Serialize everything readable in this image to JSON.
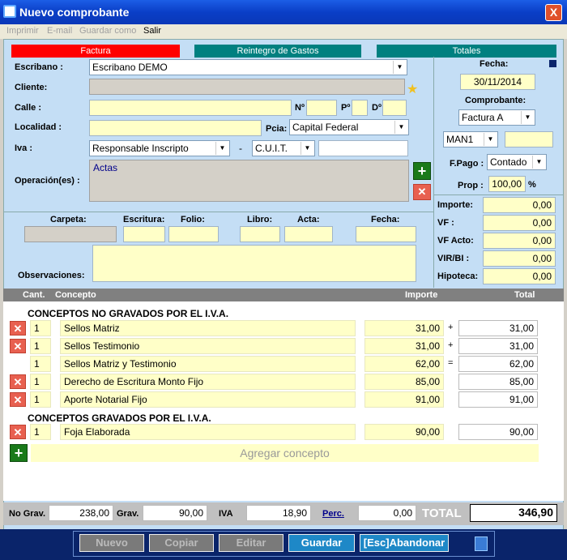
{
  "window": {
    "title": "Nuevo comprobante",
    "close": "X"
  },
  "menu": [
    {
      "label": "Imprimir",
      "active": false
    },
    {
      "label": "E-mail",
      "active": false
    },
    {
      "label": "Guardar como",
      "active": false
    },
    {
      "label": "Salir",
      "active": true
    }
  ],
  "tabs": [
    {
      "label": "Factura",
      "color": "#ff0000"
    },
    {
      "label": "Reintegro de Gastos",
      "color": "#008080"
    },
    {
      "label": "Totales",
      "color": "#008080"
    }
  ],
  "client": {
    "escribano_label": "Escribano :",
    "escribano_value": "Escribano DEMO",
    "cliente_label": "Cliente:",
    "calle_label": "Calle :",
    "nro_label": "Nº",
    "piso_label": "Pº",
    "depto_label": "Dº",
    "localidad_label": "Localidad :",
    "pcia_label": "Pcia:",
    "pcia_value": "Capital Federal",
    "iva_label": "Iva :",
    "iva_value": "Responsable Inscripto",
    "dash": "-",
    "cuit_value": "C.U.I.T.",
    "operacion_label": "Operación(es) :",
    "operacion_value": "Actas"
  },
  "right": {
    "fecha_label": "Fecha:",
    "fecha_value": "30/11/2014",
    "comprobante_label": "Comprobante:",
    "comprobante_value": "Factura A",
    "serie_value": "MAN1",
    "fpago_label": "F.Pago :",
    "fpago_value": "Contado",
    "prop_label": "Prop :",
    "prop_value": "100,00",
    "prop_unit": "%"
  },
  "escritura": {
    "carpeta": "Carpeta:",
    "escritura": "Escritura:",
    "folio": "Folio:",
    "libro": "Libro:",
    "acta": "Acta:",
    "fecha": "Fecha:",
    "observaciones": "Observaciones:"
  },
  "amounts": [
    {
      "label": "Importe:",
      "value": "0,00"
    },
    {
      "label": "VF :",
      "value": "0,00"
    },
    {
      "label": "VF Acto:",
      "value": "0,00"
    },
    {
      "label": "VIR/BI :",
      "value": "0,00"
    },
    {
      "label": "Hipoteca:",
      "value": "0,00"
    }
  ],
  "table": {
    "headers": {
      "cant": "Cant.",
      "concepto": "Concepto",
      "importe": "Importe",
      "total": "Total"
    },
    "section1": "CONCEPTOS NO GRAVADOS POR EL I.V.A.",
    "rows1": [
      {
        "del": true,
        "cant": "1",
        "concepto": "Sellos Matriz",
        "importe": "31,00",
        "op": "+",
        "total": "31,00"
      },
      {
        "del": true,
        "cant": "1",
        "concepto": "Sellos Testimonio",
        "importe": "31,00",
        "op": "+",
        "total": "31,00"
      },
      {
        "del": false,
        "cant": "1",
        "concepto": "Sellos Matriz y Testimonio",
        "importe": "62,00",
        "op": "=",
        "total": "62,00"
      },
      {
        "del": true,
        "cant": "1",
        "concepto": "Derecho de Escritura Monto Fijo",
        "importe": "85,00",
        "op": "",
        "total": "85,00"
      },
      {
        "del": true,
        "cant": "1",
        "concepto": "Aporte Notarial Fijo",
        "importe": "91,00",
        "op": "",
        "total": "91,00"
      }
    ],
    "section2": "CONCEPTOS GRAVADOS POR EL I.V.A.",
    "rows2": [
      {
        "del": true,
        "cant": "1",
        "concepto": "Foja Elaborada",
        "importe": "90,00",
        "op": "",
        "total": "90,00"
      }
    ],
    "add_label": "Agregar concepto"
  },
  "totals": {
    "nograv_label": "No Grav.",
    "nograv": "238,00",
    "grav_label": "Grav.",
    "grav": "90,00",
    "iva_label": "IVA",
    "iva": "18,90",
    "perc_label": "Perc.",
    "perc": "0,00",
    "total_label": "TOTAL",
    "total": "346,90"
  },
  "buttons": [
    {
      "label": "Nuevo",
      "state": "dis"
    },
    {
      "label": "Copiar",
      "state": "dis"
    },
    {
      "label": "Editar",
      "state": "dis"
    },
    {
      "label": "Guardar",
      "state": "act"
    },
    {
      "label": "[Esc]Abandonar",
      "state": "act"
    }
  ]
}
